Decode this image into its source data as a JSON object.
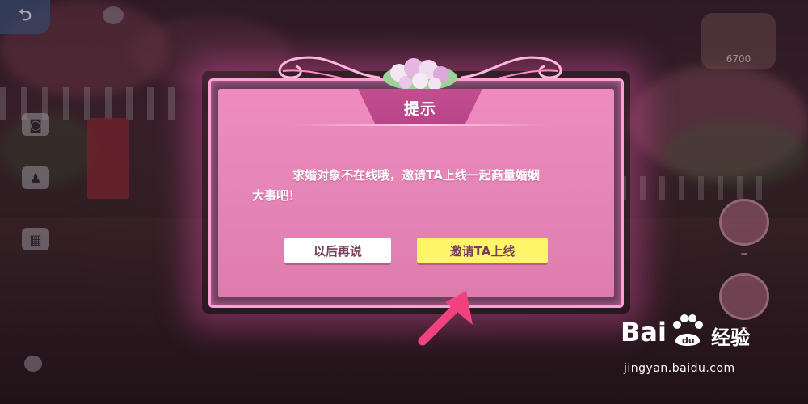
{
  "background": {
    "top_left_label": "",
    "top_intro_label": "",
    "top_right_value": "6700",
    "left_buttons": [
      {
        "icon": "camera-icon",
        "label": ""
      },
      {
        "icon": "pose-icon",
        "label": ""
      },
      {
        "icon": "image-icon",
        "label": ""
      }
    ],
    "right_buttons": [
      {
        "icon": "house-icon",
        "label": ""
      },
      {
        "icon": "flower-icon",
        "label": ""
      }
    ],
    "share_label": ""
  },
  "dialog": {
    "title": "提示",
    "message_line1": "求婚对象不在线哦，邀请TA上线一起商量婚姻",
    "message_line2": "大事吧！",
    "cancel_label": "以后再说",
    "confirm_label": "邀请TA上线"
  },
  "watermark": {
    "brand": "Bai",
    "brand_suffix": "经验",
    "url": "jingyan.baidu.com"
  },
  "colors": {
    "dialog_pink": "#ee8cbf",
    "title_tab": "#c24e8f",
    "confirm_yellow": "#fff56a",
    "arrow_pink": "#f0427e"
  }
}
